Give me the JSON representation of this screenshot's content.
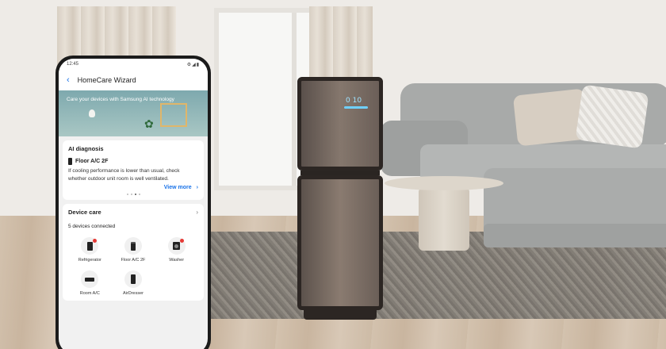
{
  "status_bar": {
    "time": "12:45",
    "icons": "⚙◢▮"
  },
  "app_bar": {
    "back_icon": "chevron-left-icon",
    "title": "HomeCare Wizard"
  },
  "banner": {
    "text": "Care your devices with Samsung AI technology"
  },
  "ai_diagnosis": {
    "title": "AI diagnosis",
    "device_name": "Floor A/C 2F",
    "message": "If cooling performance is lower than usual, check whether outdoor unit room is well ventilated.",
    "view_more": "View more",
    "chevron": "›"
  },
  "device_care": {
    "title": "Device care",
    "chevron": "›",
    "count_text": "5 devices connected",
    "devices": [
      {
        "label": "Refrigerator",
        "icon": "refrigerator-icon",
        "alert": true
      },
      {
        "label": "Floor A/C 2F",
        "icon": "floor-ac-icon",
        "alert": false
      },
      {
        "label": "Washer",
        "icon": "washer-icon",
        "alert": true
      },
      {
        "label": "Room A/C",
        "icon": "room-ac-icon",
        "alert": false
      },
      {
        "label": "AirDresser",
        "icon": "airdresser-icon",
        "alert": false
      }
    ]
  },
  "purifier_display": "0 10",
  "colors": {
    "accent": "#1a73e8",
    "alert": "#e53935"
  }
}
